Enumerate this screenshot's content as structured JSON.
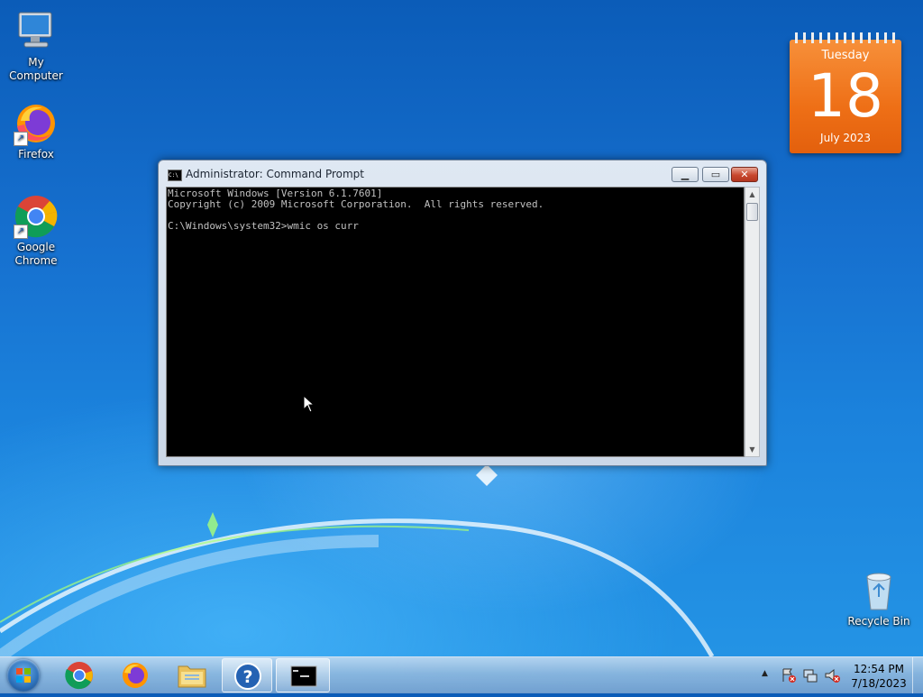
{
  "desktop": {
    "icons": [
      {
        "label": "My Computer"
      },
      {
        "label": "Firefox"
      },
      {
        "label": "Google Chrome"
      },
      {
        "label": "Recycle Bin"
      }
    ]
  },
  "calendar": {
    "weekday": "Tuesday",
    "day": "18",
    "month_year": "July 2023"
  },
  "window": {
    "title": "Administrator: Command Prompt",
    "console_text": "Microsoft Windows [Version 6.1.7601]\nCopyright (c) 2009 Microsoft Corporation.  All rights reserved.\n\nC:\\Windows\\system32>wmic os curr"
  },
  "taskbar": {
    "clock_time": "12:54 PM",
    "clock_date": "7/18/2023",
    "tray_arrow": "▲"
  },
  "colors": {
    "calendar_orange": "#ee6f16",
    "console_bg": "#000000",
    "console_text": "#c0c0c0"
  }
}
